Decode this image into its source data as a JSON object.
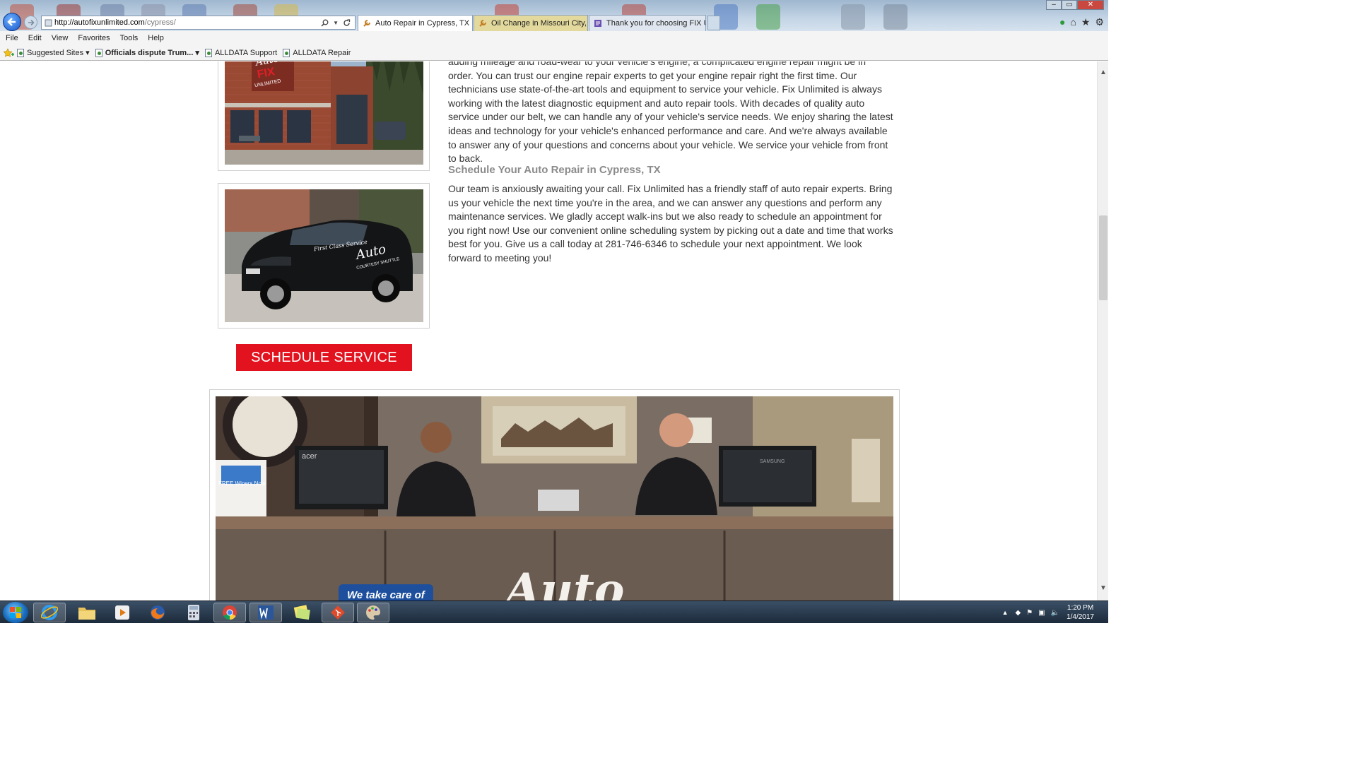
{
  "browser": {
    "address_host": "http://autofixunlimited.com",
    "address_path": "/cypress/",
    "tabs": [
      {
        "title": "Auto Repair in Cypress, TX |...",
        "active": true
      },
      {
        "title": "Oil Change in Missouri City, T...",
        "active": false
      },
      {
        "title": "Thank you for choosing FIX Un...",
        "active": false
      }
    ],
    "menu": [
      "File",
      "Edit",
      "View",
      "Favorites",
      "Tools",
      "Help"
    ],
    "favorites": [
      "Suggested Sites ▾",
      "Officials dispute Trum... ▾",
      "ALLDATA Support",
      "ALLDATA Repair"
    ]
  },
  "page": {
    "intro_paragraph": "adding mileage and road-wear to your vehicle's engine, a complicated engine repair might be in order. You can trust our engine repair experts to get your engine repair right the first time. Our technicians use state-of-the-art tools and equipment to service your vehicle. Fix Unlimited is always working with the latest diagnostic equipment and auto repair tools. With decades of quality auto service under our belt, we can handle any of your vehicle's service needs. We enjoy sharing the latest ideas and technology for your vehicle's enhanced performance and care. And we're always available to answer any of your questions and concerns about your vehicle. We service your vehicle from front to back.",
    "schedule_heading": "Schedule Your Auto Repair in Cypress, TX",
    "schedule_paragraph": "Our team is anxiously awaiting your call. Fix Unlimited has a friendly staff of auto repair experts. Bring us your vehicle the next time you're in the area, and we can answer any questions and perform any maintenance services. We gladly accept walk-ins but we also ready to schedule an appointment for you right now! Use our convenient online scheduling system by picking out a date and time that works best for you. Give us a call today at 281-746-6346 to schedule your next appointment. We look forward to meeting you!",
    "schedule_button": "SCHEDULE SERVICE",
    "photo_text": {
      "shop_sign_auto": "Auto",
      "shop_sign_fix": "FIX",
      "shop_sign_unlimited": "UNLIMITED",
      "van_auto": "Auto",
      "van_first_class": "First Class Service",
      "van_courtesy": "COURTESY SHUTTLE",
      "monitor_left_brand": "acer",
      "monitor_right_brand": "SAMSUNG",
      "free_wipers": "FREE Wipers Now",
      "banner_text": "We take care of",
      "desk_logo": "Auto"
    }
  },
  "taskbar": {
    "time": "1:20 PM",
    "date": "1/4/2017"
  },
  "colors": {
    "brand_red": "#e3121f",
    "heading_gray": "#8b8b8b",
    "body_text": "#333333"
  }
}
